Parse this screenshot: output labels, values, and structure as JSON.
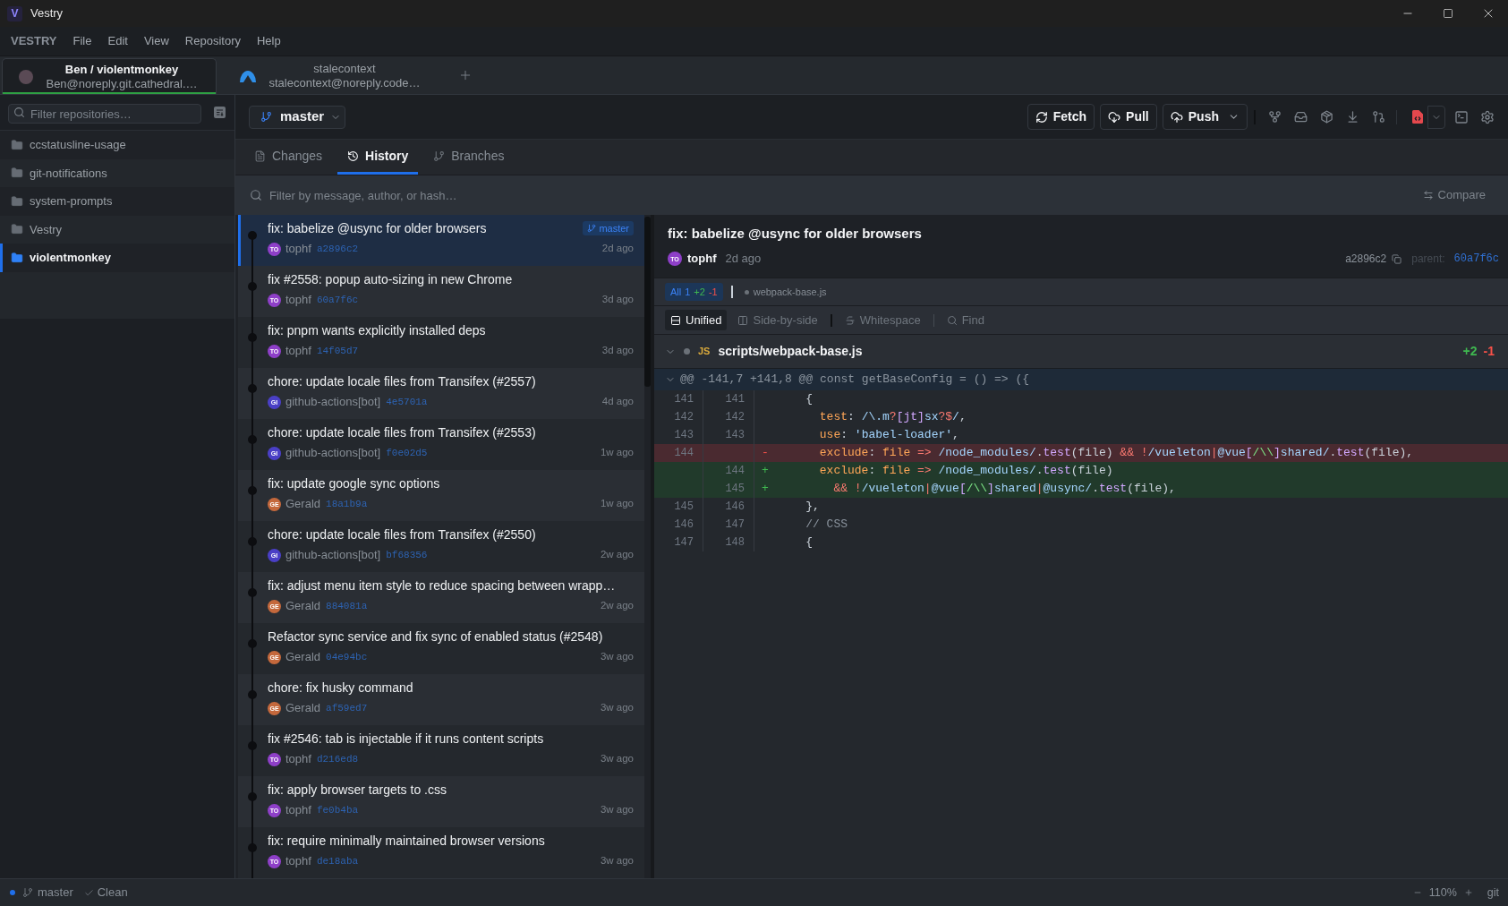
{
  "window": {
    "logo": "V",
    "title": "Vestry"
  },
  "menu": [
    "VESTRY",
    "File",
    "Edit",
    "View",
    "Repository",
    "Help"
  ],
  "accounts": [
    {
      "kind": "user",
      "name": "Ben / violentmonkey",
      "email": "Ben@noreply.git.cathedral.…",
      "selected": true
    },
    {
      "kind": "service",
      "name": "stalecontext",
      "email": "stalecontext@noreply.code…",
      "selected": false
    }
  ],
  "sidebar": {
    "filter_placeholder": "Filter repositories…",
    "repositories": [
      {
        "name": "ccstatusline-usage",
        "selected": false
      },
      {
        "name": "git-notifications",
        "selected": false
      },
      {
        "name": "system-prompts",
        "selected": false
      },
      {
        "name": "Vestry",
        "selected": false
      },
      {
        "name": "violentmonkey",
        "selected": true
      }
    ]
  },
  "branch_selector": {
    "branch": "master"
  },
  "toolbar": [
    {
      "kind": "fetch",
      "label": "Fetch",
      "dropdown": false
    },
    {
      "kind": "pull",
      "label": "Pull",
      "dropdown": false
    },
    {
      "kind": "push",
      "label": "Push",
      "dropdown": true
    }
  ],
  "tabs": [
    {
      "kind": "changes",
      "label": "Changes",
      "selected": false
    },
    {
      "kind": "history",
      "label": "History",
      "selected": true
    },
    {
      "kind": "branches",
      "label": "Branches",
      "selected": false
    }
  ],
  "history_filter": {
    "placeholder": "Filter by message, author, or hash…",
    "compare": "Compare"
  },
  "commits": [
    {
      "message": "fix: babelize @usync for older browsers",
      "initials": "TO",
      "color": "#8e3fc8",
      "author": "tophf",
      "hash": "a2896c2",
      "time": "2d ago",
      "badge": "master",
      "selected": true
    },
    {
      "message": "fix #2558: popup auto-sizing in new Chrome",
      "initials": "TO",
      "color": "#8e3fc8",
      "author": "tophf",
      "hash": "60a7f6c",
      "time": "3d ago",
      "selected": false
    },
    {
      "message": "fix: pnpm wants explicitly installed deps",
      "initials": "TO",
      "color": "#8e3fc8",
      "author": "tophf",
      "hash": "14f05d7",
      "time": "3d ago",
      "selected": false
    },
    {
      "message": "chore: update locale files from Transifex (#2557)",
      "initials": "GI",
      "color": "#4a3fc6",
      "author": "github-actions[bot]",
      "hash": "4e5701a",
      "time": "4d ago",
      "selected": false
    },
    {
      "message": "chore: update locale files from Transifex (#2553)",
      "initials": "GI",
      "color": "#4a3fc6",
      "author": "github-actions[bot]",
      "hash": "f0e02d5",
      "time": "1w ago",
      "selected": false
    },
    {
      "message": "fix: update google sync options",
      "initials": "GE",
      "color": "#c4683c",
      "author": "Gerald",
      "hash": "18a1b9a",
      "time": "1w ago",
      "selected": false
    },
    {
      "message": "chore: update locale files from Transifex (#2550)",
      "initials": "GI",
      "color": "#4a3fc6",
      "author": "github-actions[bot]",
      "hash": "bf68356",
      "time": "2w ago",
      "selected": false
    },
    {
      "message": "fix: adjust menu item style to reduce spacing between wrapp…",
      "initials": "GE",
      "color": "#c4683c",
      "author": "Gerald",
      "hash": "884081a",
      "time": "2w ago",
      "selected": false
    },
    {
      "message": "Refactor sync service and fix sync of enabled status (#2548)",
      "initials": "GE",
      "color": "#c4683c",
      "author": "Gerald",
      "hash": "04e94bc",
      "time": "3w ago",
      "selected": false
    },
    {
      "message": "chore: fix husky command",
      "initials": "GE",
      "color": "#c4683c",
      "author": "Gerald",
      "hash": "af59ed7",
      "time": "3w ago",
      "selected": false
    },
    {
      "message": "fix #2546: tab is injectable if it runs content scripts",
      "initials": "TO",
      "color": "#8e3fc8",
      "author": "tophf",
      "hash": "d216ed8",
      "time": "3w ago",
      "selected": false
    },
    {
      "message": "fix: apply browser targets to .css",
      "initials": "TO",
      "color": "#8e3fc8",
      "author": "tophf",
      "hash": "fe0b4ba",
      "time": "3w ago",
      "selected": false
    },
    {
      "message": "fix: require minimally maintained browser versions",
      "initials": "TO",
      "color": "#8e3fc8",
      "author": "tophf",
      "hash": "de18aba",
      "time": "3w ago",
      "selected": false
    }
  ],
  "detail": {
    "title": "fix: babelize @usync for older browsers",
    "avatar": {
      "initials": "TO",
      "color": "#8e3fc8"
    },
    "author": "tophf",
    "time": "2d ago",
    "hash": "a2896c2",
    "parent_label": "parent:",
    "parent_hash": "60a7f6c",
    "file_filter": {
      "label": "All",
      "count": "1",
      "additions": "+2",
      "deletions": "-1",
      "selected": true
    },
    "file_chips": [
      {
        "name": "webpack-base.js",
        "selected": false
      }
    ],
    "view_modes": [
      {
        "kind": "unified",
        "label": "Unified",
        "selected": true
      },
      {
        "kind": "split",
        "label": "Side-by-side",
        "selected": false
      }
    ],
    "whitespace": "Whitespace",
    "find": "Find",
    "file": {
      "language": "JS",
      "path": "scripts/webpack-base.js",
      "additions": "+2",
      "deletions": "-1",
      "expanded": true
    },
    "hunk": {
      "header": "@@ -141,7 +141,8 @@ const getBaseConfig = () => ({",
      "expanded": true
    },
    "lines": [
      {
        "kind": "context",
        "old": "141",
        "new": "141",
        "tokens": [
          {
            "kind": "plain",
            "text": "    {"
          }
        ]
      },
      {
        "kind": "context",
        "old": "142",
        "new": "142",
        "tokens": [
          {
            "kind": "key",
            "text": "      test"
          },
          {
            "kind": "plain",
            "text": ": "
          },
          {
            "kind": "regex",
            "text": "/\\.m"
          },
          {
            "kind": "op",
            "text": "?"
          },
          {
            "kind": "bracket",
            "text": "[jt]"
          },
          {
            "kind": "regex",
            "text": "sx"
          },
          {
            "kind": "op",
            "text": "?$"
          },
          {
            "kind": "regex",
            "text": "/"
          },
          {
            "kind": "plain",
            "text": ","
          }
        ]
      },
      {
        "kind": "context",
        "old": "143",
        "new": "143",
        "tokens": [
          {
            "kind": "key",
            "text": "      use"
          },
          {
            "kind": "plain",
            "text": ": "
          },
          {
            "kind": "string",
            "text": "'babel-loader'"
          },
          {
            "kind": "plain",
            "text": ","
          }
        ]
      },
      {
        "kind": "deleted",
        "old": "144",
        "sign": "-",
        "tokens": [
          {
            "kind": "key",
            "text": "      exclude"
          },
          {
            "kind": "plain",
            "text": ": "
          },
          {
            "kind": "param",
            "text": "file"
          },
          {
            "kind": "op",
            "text": " => "
          },
          {
            "kind": "regex",
            "text": "/node_modules/"
          },
          {
            "kind": "plain",
            "text": "."
          },
          {
            "kind": "method",
            "text": "test"
          },
          {
            "kind": "plain",
            "text": "(file) "
          },
          {
            "kind": "op",
            "text": "&& !"
          },
          {
            "kind": "regex",
            "text": "/vueleton"
          },
          {
            "kind": "op",
            "text": "|"
          },
          {
            "kind": "regex",
            "text": "@vue"
          },
          {
            "kind": "bracket",
            "text": "["
          },
          {
            "kind": "escape",
            "text": "/\\\\"
          },
          {
            "kind": "bracket",
            "text": "]"
          },
          {
            "kind": "regex",
            "text": "shared/"
          },
          {
            "kind": "plain",
            "text": "."
          },
          {
            "kind": "method",
            "text": "test"
          },
          {
            "kind": "plain",
            "text": "(file),"
          }
        ]
      },
      {
        "kind": "added",
        "new": "144",
        "sign": "+",
        "tokens": [
          {
            "kind": "key",
            "text": "      exclude"
          },
          {
            "kind": "plain",
            "text": ": "
          },
          {
            "kind": "param",
            "text": "file"
          },
          {
            "kind": "op",
            "text": " => "
          },
          {
            "kind": "regex",
            "text": "/node_modules/"
          },
          {
            "kind": "plain",
            "text": "."
          },
          {
            "kind": "method",
            "text": "test"
          },
          {
            "kind": "plain",
            "text": "(file)"
          }
        ]
      },
      {
        "kind": "added",
        "new": "145",
        "sign": "+",
        "tokens": [
          {
            "kind": "op",
            "text": "        && !"
          },
          {
            "kind": "regex",
            "text": "/vueleton"
          },
          {
            "kind": "op",
            "text": "|"
          },
          {
            "kind": "regex",
            "text": "@vue"
          },
          {
            "kind": "bracket",
            "text": "["
          },
          {
            "kind": "escape",
            "text": "/\\\\"
          },
          {
            "kind": "bracket",
            "text": "]"
          },
          {
            "kind": "regex",
            "text": "shared"
          },
          {
            "kind": "op",
            "text": "|"
          },
          {
            "kind": "regex",
            "text": "@usync/"
          },
          {
            "kind": "plain",
            "text": "."
          },
          {
            "kind": "method",
            "text": "test"
          },
          {
            "kind": "plain",
            "text": "(file),"
          }
        ]
      },
      {
        "kind": "context",
        "old": "145",
        "new": "146",
        "tokens": [
          {
            "kind": "plain",
            "text": "    },"
          }
        ]
      },
      {
        "kind": "context",
        "old": "146",
        "new": "147",
        "tokens": [
          {
            "kind": "comment",
            "text": "    // CSS"
          }
        ]
      },
      {
        "kind": "context",
        "old": "147",
        "new": "148",
        "tokens": [
          {
            "kind": "plain",
            "text": "    {"
          }
        ]
      }
    ]
  },
  "status_bar": {
    "branch": "master",
    "state": "Clean",
    "zoom": "110%",
    "vcs": "git"
  }
}
